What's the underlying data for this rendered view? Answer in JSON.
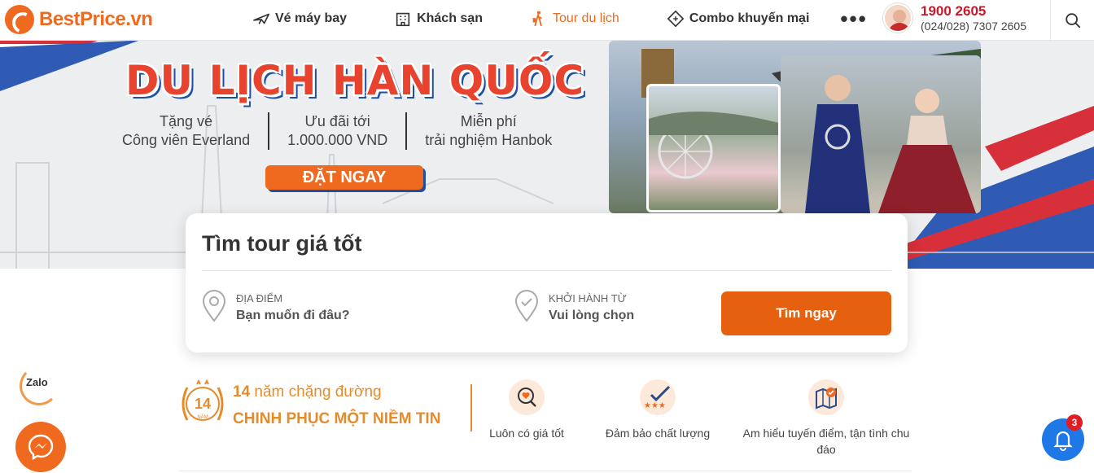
{
  "brand": {
    "name": "BestPrice.vn"
  },
  "nav": {
    "items": [
      {
        "label": "Vé máy bay",
        "icon": "plane-icon",
        "active": false
      },
      {
        "label": "Khách sạn",
        "icon": "hotel-icon",
        "active": false
      },
      {
        "label": "Tour du lịch",
        "icon": "traveler-icon",
        "active": true
      },
      {
        "label": "Combo khuyến mại",
        "icon": "ticket-icon",
        "active": false
      }
    ],
    "more": "•••"
  },
  "contact": {
    "hotline": "1900 2605",
    "phone": "(024/028) 7307 2605"
  },
  "banner": {
    "title": "DU LỊCH HÀN QUỐC",
    "perks": [
      {
        "line1": "Tặng vé",
        "line2": "Công viên Everland"
      },
      {
        "line1": "Ưu đãi tới",
        "line2": "1.000.000 VND"
      },
      {
        "line1": "Miễn phí",
        "line2": "trải nghiệm Hanbok"
      }
    ],
    "cta": "ĐẶT NGAY"
  },
  "search": {
    "title": "Tìm tour giá tốt",
    "destination": {
      "label": "ĐỊA ĐIỂM",
      "value": "Bạn muốn đi đâu?"
    },
    "departure": {
      "label": "KHỞI HÀNH TỪ",
      "value": "Vui lòng chọn"
    },
    "submit": "Tìm ngay"
  },
  "trust": {
    "badge_number": "14",
    "badge_unit": "NĂM",
    "years_number": "14",
    "years_text": "năm chặng đường",
    "slogan": "CHINH PHỤC MỘT NIỀM TIN",
    "features": [
      {
        "label": "Luôn có giá tốt",
        "icon": "heart-search-icon"
      },
      {
        "label": "Đảm bảo chất lượng",
        "icon": "stars-check-icon"
      },
      {
        "label": "Am hiểu tuyến điểm, tận tình chu đáo",
        "icon": "map-check-icon"
      }
    ]
  },
  "floating": {
    "zalo": "Zalo",
    "notification_count": "3"
  },
  "colors": {
    "brand": "#ef6a1f",
    "hotline": "#c9172b",
    "accent_blue": "#1e78e6",
    "gold": "#e68b2a"
  }
}
